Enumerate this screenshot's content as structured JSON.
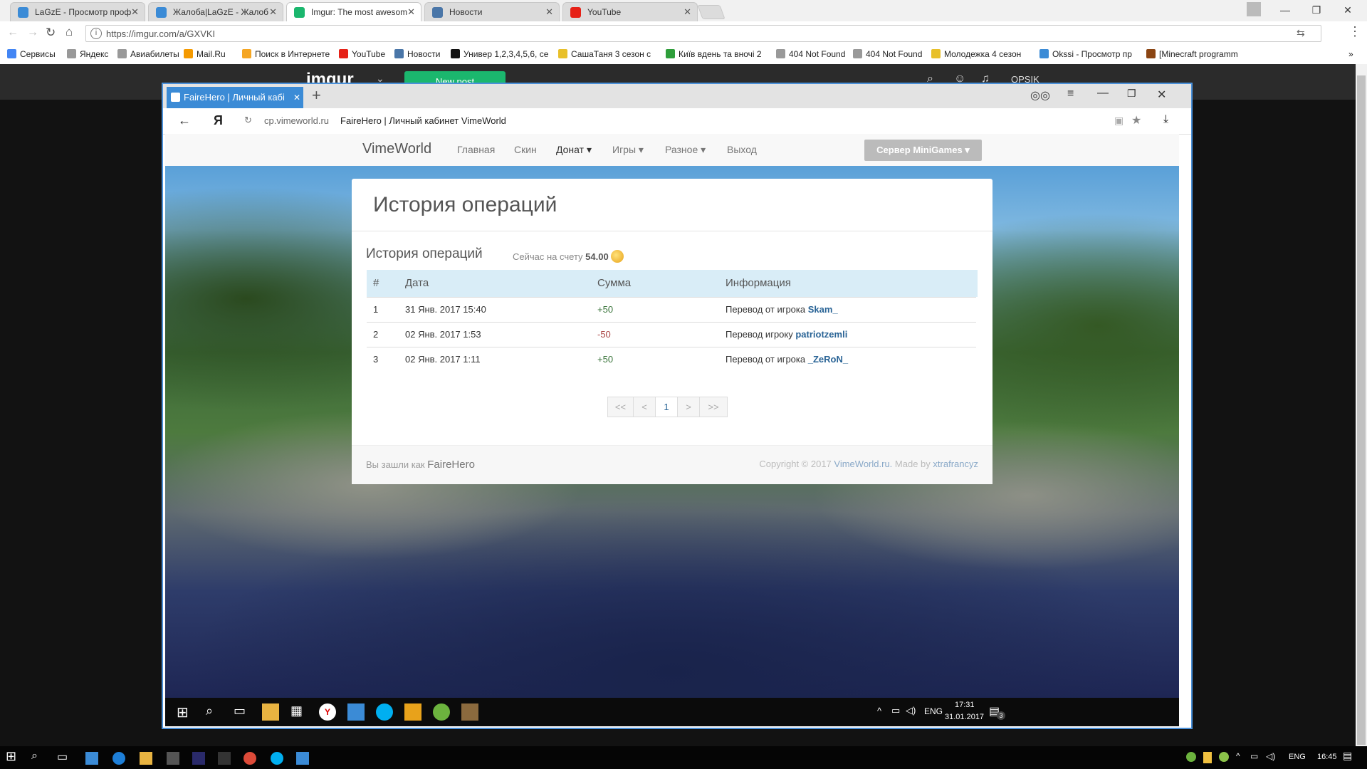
{
  "chrome": {
    "tabs": [
      {
        "title": "LaGzE - Просмотр проф",
        "color": "#3b8bd6"
      },
      {
        "title": "Жалоба|LaGzE - Жалоб",
        "color": "#3b8bd6"
      },
      {
        "title": "Imgur: The most awesom",
        "color": "#1bb76e"
      },
      {
        "title": "Новости",
        "color": "#4a76a8"
      },
      {
        "title": "YouTube",
        "color": "#e62117"
      }
    ],
    "url": "https://imgur.com/a/GXVKI",
    "bookmarks": [
      {
        "label": "Сервисы",
        "color": "#4285f4"
      },
      {
        "label": "Яндекс",
        "color": "#999999"
      },
      {
        "label": "Авиабилеты",
        "color": "#999999"
      },
      {
        "label": "Mail.Ru",
        "color": "#f59a00"
      },
      {
        "label": "Поиск в Интернете",
        "color": "#f5a623"
      },
      {
        "label": "YouTube",
        "color": "#e62117"
      },
      {
        "label": "Новости",
        "color": "#4a76a8"
      },
      {
        "label": "Универ 1,2,3,4,5,6, се",
        "color": "#111111"
      },
      {
        "label": "СашаТаня 3 сезон с",
        "color": "#e8c02a"
      },
      {
        "label": "Київ вдень та вночі 2",
        "color": "#2e9e3a"
      },
      {
        "label": "404 Not Found",
        "color": "#999999"
      },
      {
        "label": "404 Not Found",
        "color": "#999999"
      },
      {
        "label": "Молодежка 4 сезон",
        "color": "#e8c02a"
      },
      {
        "label": "Okssi - Просмотр пр",
        "color": "#3b8bd6"
      },
      {
        "label": "[Minecraft programm",
        "color": "#8b4513"
      }
    ]
  },
  "imgur": {
    "logo": "imgur",
    "new_post": "New post",
    "username": "OPSIK"
  },
  "yandex": {
    "tab_title": "FaireHero | Личный кабі",
    "domain": "cp.vimeworld.ru",
    "page_title": "FaireHero | Личный кабинет VimeWorld"
  },
  "site": {
    "brand": "VimeWorld",
    "nav": [
      "Главная",
      "Скин",
      "Донат",
      "Игры",
      "Разное",
      "Выход"
    ],
    "server_button": "Сервер MiniGames",
    "panel_title": "История операций",
    "section_title": "История операций",
    "balance_label": "Сейчас на счету",
    "balance_value": "54.00",
    "table": {
      "headers": [
        "#",
        "Дата",
        "Сумма",
        "Информация"
      ],
      "rows": [
        {
          "n": "1",
          "date": "31 Янв. 2017 15:40",
          "sum": "+50",
          "info": "Перевод от игрока",
          "player": "Skam_"
        },
        {
          "n": "2",
          "date": "02 Янв. 2017 1:53",
          "sum": "-50",
          "info": "Перевод игроку",
          "player": "patriotzemli"
        },
        {
          "n": "3",
          "date": "02 Янв. 2017 1:11",
          "sum": "+50",
          "info": "Перевод от игрока",
          "player": "_ZeRoN_"
        }
      ]
    },
    "pagination": [
      "<<",
      "<",
      "1",
      ">",
      ">>"
    ],
    "footer": {
      "logged_as": "Вы зашли как",
      "user": "FaireHero",
      "copyright": "Copyright © 2017",
      "site_link": "VimeWorld.ru.",
      "made_by": "Made by",
      "author": "xtrafrancyz"
    },
    "colors": {
      "positive": "#3c763d",
      "negative": "#a94442",
      "link": "#2a6496",
      "header_bg": "#d9edf7"
    }
  },
  "inner_taskbar": {
    "time": "17:31",
    "date": "31.01.2017",
    "lang": "ENG",
    "notifications": "3"
  },
  "taskbar": {
    "time": "16:45",
    "lang": "ENG"
  }
}
